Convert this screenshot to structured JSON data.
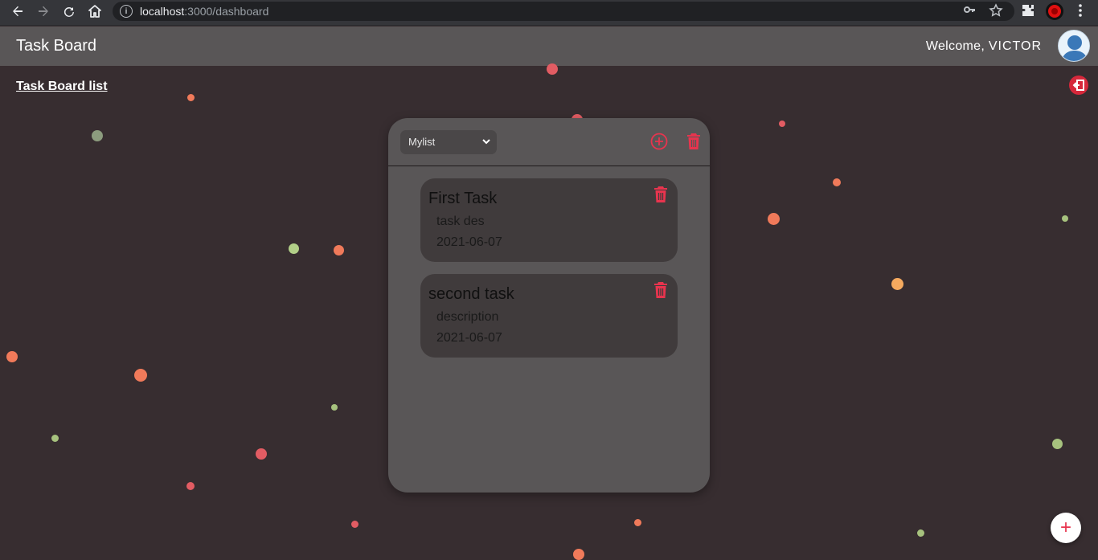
{
  "browser": {
    "url_host": "localhost",
    "url_path": ":3000/dashboard"
  },
  "header": {
    "title": "Task Board",
    "welcome_prefix": "Welcome, ",
    "username": "VICTOR"
  },
  "nav": {
    "board_list_link": "Task Board list"
  },
  "board": {
    "selected_list": "Mylist",
    "tasks": [
      {
        "title": "First Task",
        "description": "task des",
        "date": "2021-06-07"
      },
      {
        "title": "second task",
        "description": "description",
        "date": "2021-06-07"
      }
    ]
  },
  "fab": {
    "label": "+"
  },
  "colors": {
    "accent_red": "#e8344e",
    "header_bg": "#595657",
    "page_bg": "#372d30",
    "card_bg": "#403b3c"
  }
}
